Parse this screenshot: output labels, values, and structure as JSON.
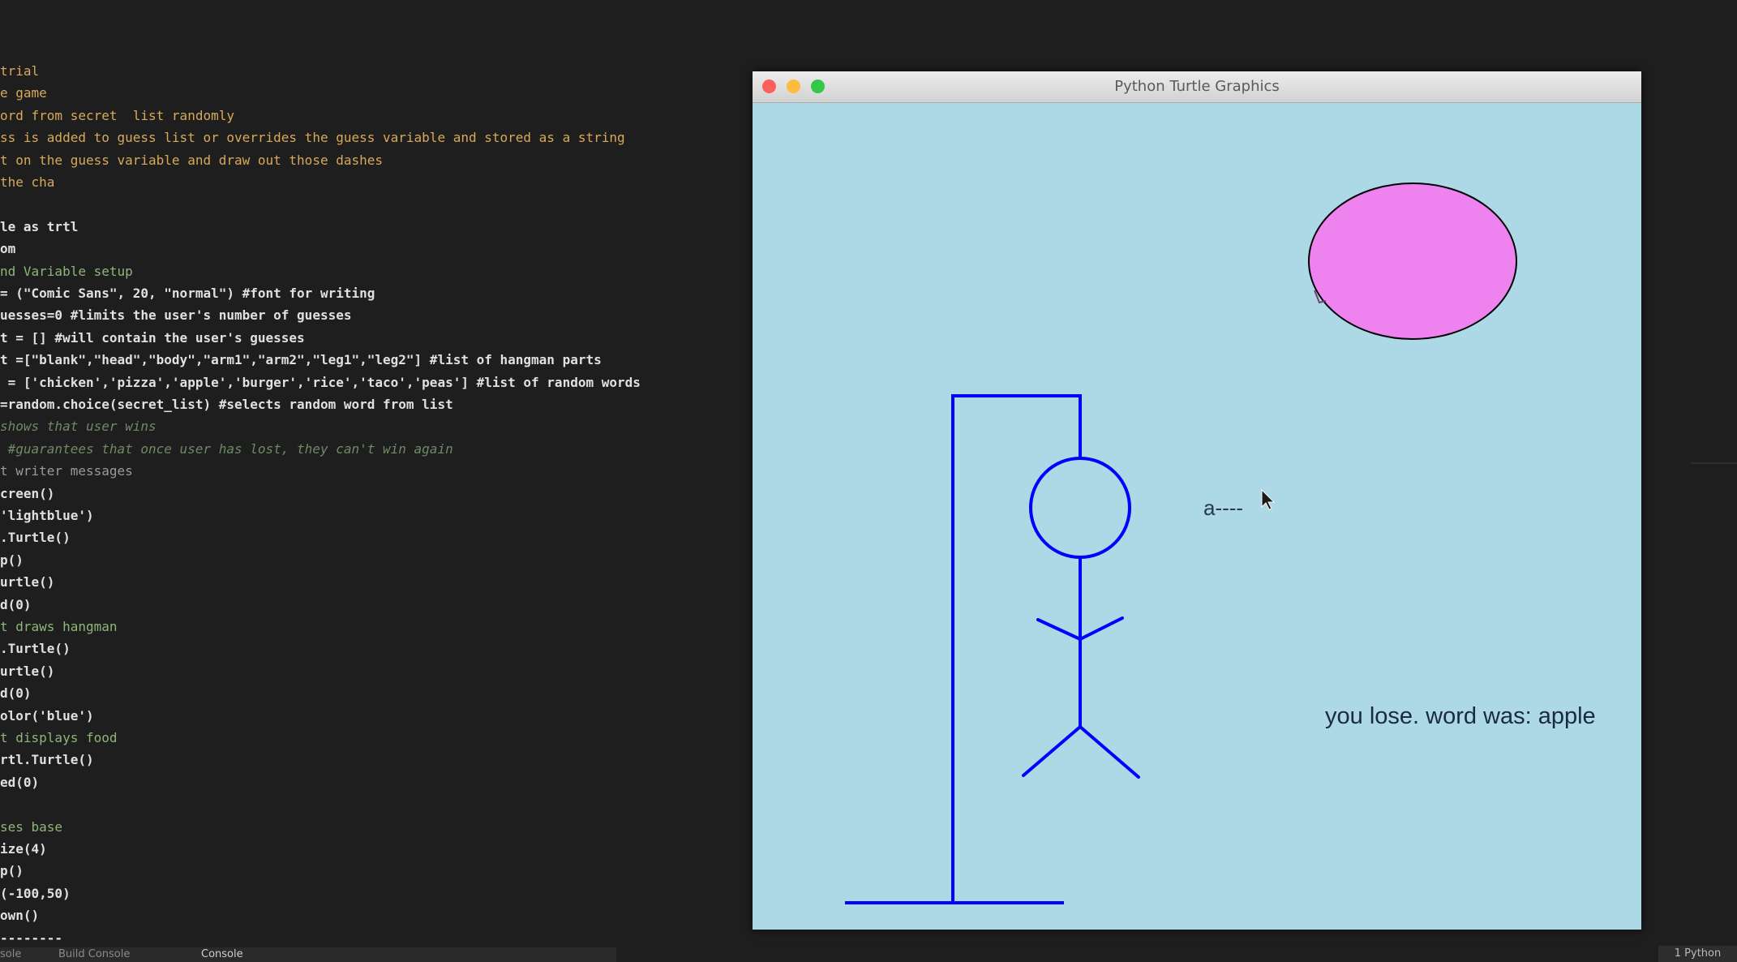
{
  "editor": {
    "lines": [
      {
        "text": "trial",
        "kind": "comment"
      },
      {
        "text": "e game",
        "kind": "comment"
      },
      {
        "text": "ord from secret  list randomly",
        "kind": "comment"
      },
      {
        "text": "ss is added to guess list or overrides the guess variable and stored as a string",
        "kind": "comment"
      },
      {
        "text": "t on the guess variable and draw out those dashes",
        "kind": "comment"
      },
      {
        "text": "the cha",
        "kind": "comment"
      },
      {
        "text": "",
        "kind": "code"
      },
      {
        "text": "le as trtl",
        "kind": "code"
      },
      {
        "text": "om",
        "kind": "code"
      },
      {
        "text": "nd Variable setup",
        "kind": "green"
      },
      {
        "text": "= (\"Comic Sans\", 20, \"normal\") #font for writing",
        "kind": "code"
      },
      {
        "text": "uesses=0 #limits the user's number of guesses",
        "kind": "code"
      },
      {
        "text": "t = [] #will contain the user's guesses",
        "kind": "code"
      },
      {
        "text": "t =[\"blank\",\"head\",\"body\",\"arm1\",\"arm2\",\"leg1\",\"leg2\"] #list of hangman parts",
        "kind": "code"
      },
      {
        "text": " = ['chicken','pizza','apple','burger','rice','taco','peas'] #list of random words",
        "kind": "code"
      },
      {
        "text": "=random.choice(secret_list) #selects random word from list",
        "kind": "code"
      },
      {
        "text": "shows that user wins",
        "kind": "dim"
      },
      {
        "text": " #guarantees that once user has lost, they can't win again",
        "kind": "dim"
      },
      {
        "text": "t writer messages",
        "kind": "sel"
      },
      {
        "text": "creen()",
        "kind": "code"
      },
      {
        "text": "'lightblue')",
        "kind": "code"
      },
      {
        "text": ".Turtle()",
        "kind": "code"
      },
      {
        "text": "p()",
        "kind": "code"
      },
      {
        "text": "urtle()",
        "kind": "code"
      },
      {
        "text": "d(0)",
        "kind": "code"
      },
      {
        "text": "t draws hangman",
        "kind": "green"
      },
      {
        "text": ".Turtle()",
        "kind": "code"
      },
      {
        "text": "urtle()",
        "kind": "code"
      },
      {
        "text": "d(0)",
        "kind": "code"
      },
      {
        "text": "olor('blue')",
        "kind": "code"
      },
      {
        "text": "t displays food",
        "kind": "green"
      },
      {
        "text": "rtl.Turtle()",
        "kind": "code"
      },
      {
        "text": "ed(0)",
        "kind": "code"
      },
      {
        "text": "",
        "kind": "code"
      },
      {
        "text": "ses base",
        "kind": "green"
      },
      {
        "text": "ize(4)",
        "kind": "code"
      },
      {
        "text": "p()",
        "kind": "code"
      },
      {
        "text": "(-100,50)",
        "kind": "code"
      },
      {
        "text": "own()",
        "kind": "code"
      },
      {
        "text": "--------",
        "kind": "code"
      }
    ],
    "status_left": [
      "sole",
      "Build Console",
      "Console"
    ],
    "status_right": "1 Python"
  },
  "window": {
    "title": "Python Turtle Graphics",
    "close_color": "#fc605b",
    "minimize_color": "#fdbc40",
    "zoom_color": "#34c84a"
  },
  "canvas": {
    "background": "#add8e6",
    "guess_display": "a----",
    "message": "you lose. word was: apple",
    "hangman_color": "blue",
    "food_fill": "#ee82ee",
    "food_outline": "#000000"
  }
}
